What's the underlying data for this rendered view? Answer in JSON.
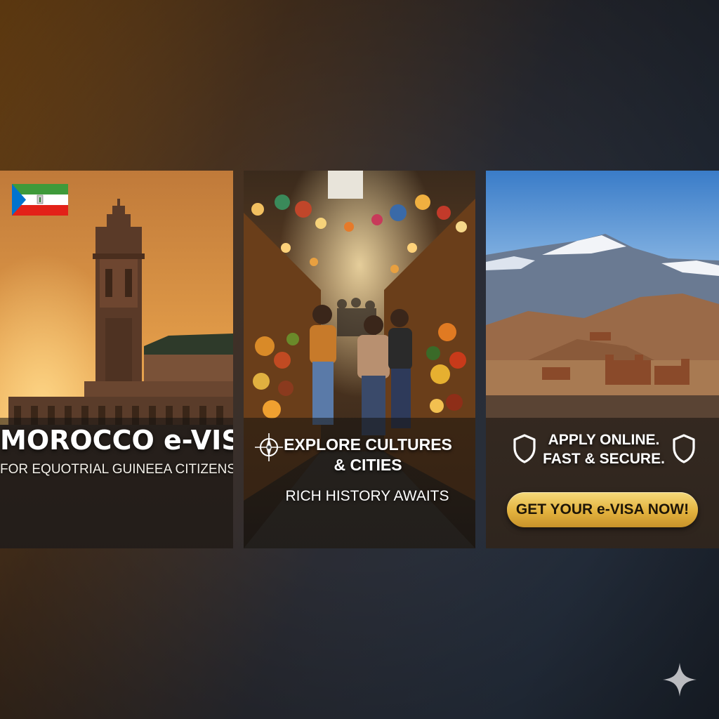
{
  "panel_left": {
    "title": "MOROCCO e-VISA",
    "subtitle": "FOR EQUOTRIAL GUINEEA CITIZENS",
    "flag_icon": "equatorial-guinea-flag-icon",
    "scene": "hassan-ii-mosque-sunset"
  },
  "panel_middle": {
    "title": "EXPLORE CULTURES & CITIES",
    "subtitle": "RICH HISTORY AWAITS",
    "icon": "compass-icon",
    "scene": "moroccan-souk-market"
  },
  "panel_right": {
    "title": "APPLY ONLINE. FAST & SECURE.",
    "icon": "shield-icon",
    "cta_label": "GET YOUR e-VISA NOW!",
    "scene": "atlas-mountains-kasbah"
  },
  "colors": {
    "cta_gold": "#e3b23e",
    "text_white": "#ffffff",
    "flag_green": "#3e9a3a",
    "flag_red": "#e32118",
    "flag_blue": "#0073ce"
  },
  "watermark_icon": "sparkle-icon"
}
